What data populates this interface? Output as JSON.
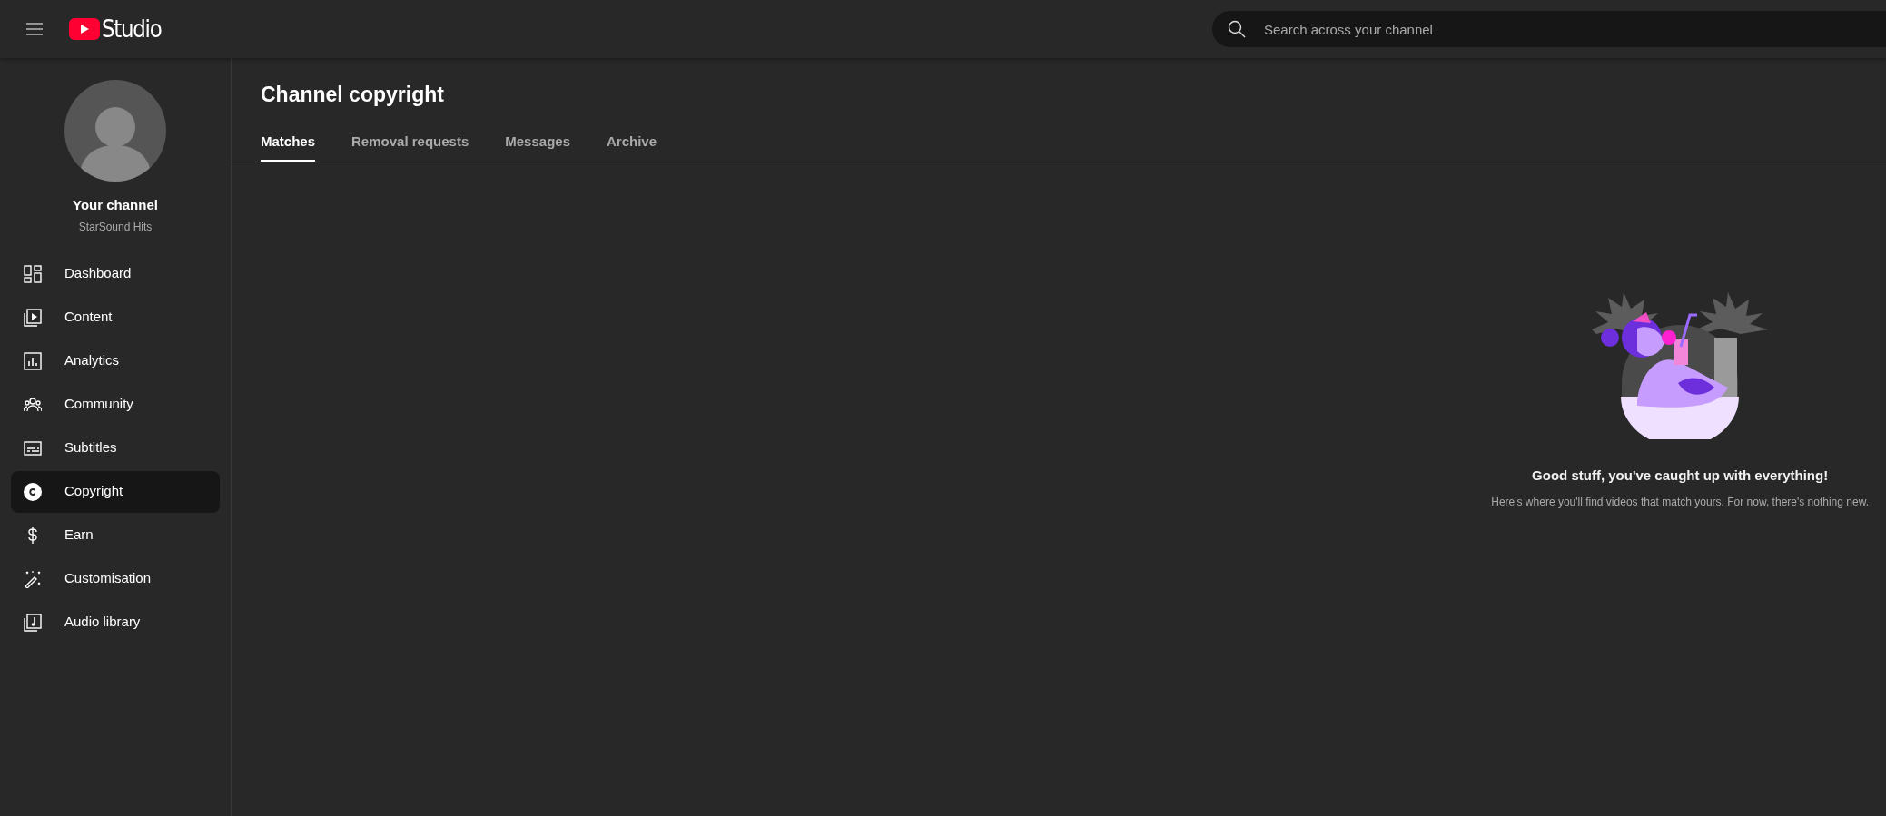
{
  "header": {
    "logo_text": "Studio",
    "search": {
      "placeholder": "Search across your channel"
    }
  },
  "sidebar": {
    "channel": {
      "title": "Your channel",
      "name": "StarSound Hits"
    },
    "items": [
      {
        "label": "Dashboard",
        "selected": false
      },
      {
        "label": "Content",
        "selected": false
      },
      {
        "label": "Analytics",
        "selected": false
      },
      {
        "label": "Community",
        "selected": false
      },
      {
        "label": "Subtitles",
        "selected": false
      },
      {
        "label": "Copyright",
        "selected": true
      },
      {
        "label": "Earn",
        "selected": false
      },
      {
        "label": "Customisation",
        "selected": false
      },
      {
        "label": "Audio library",
        "selected": false
      }
    ]
  },
  "page": {
    "title": "Channel copyright",
    "tabs": [
      {
        "label": "Matches",
        "selected": true
      },
      {
        "label": "Removal requests",
        "selected": false
      },
      {
        "label": "Messages",
        "selected": false
      },
      {
        "label": "Archive",
        "selected": false
      }
    ],
    "empty_state": {
      "heading": "Good stuff, you've caught up with everything!",
      "text": "Here's where you'll find videos that match yours. For now, there's nothing new."
    }
  }
}
